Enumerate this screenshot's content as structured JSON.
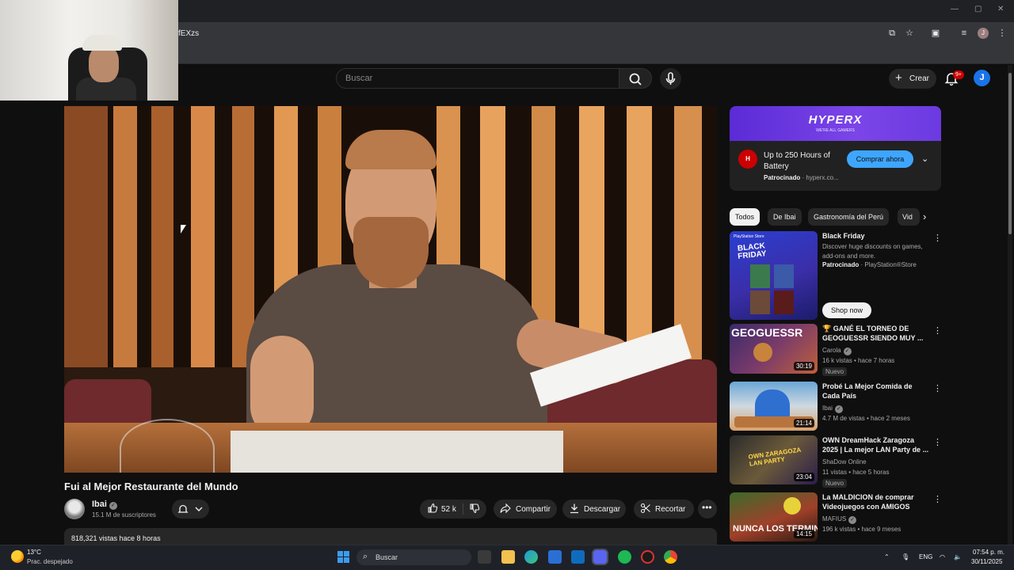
{
  "browser": {
    "url_fragment": "fEXzs",
    "profile_initial": "J"
  },
  "header": {
    "search_placeholder": "Buscar",
    "create_label": "Crear",
    "notifications_badge": "9+",
    "avatar_initial": "J"
  },
  "video": {
    "title": "Fui al Mejor Restaurante del Mundo",
    "channel": "Ibai",
    "subscribers": "15.1 M de suscriptores",
    "likes": "52 k",
    "share_label": "Compartir",
    "download_label": "Descargar",
    "clip_label": "Recortar",
    "views_time": "818,321 vistas  hace 8 horas"
  },
  "ad": {
    "brand_logo": "HYPERX",
    "slogan": "WE'RE ALL GAMERS",
    "icon_text": "H",
    "headline": "Up to 250 Hours of Battery",
    "sponsored": "Patrocinado",
    "domain": "hyperx.co...",
    "cta": "Comprar ahora"
  },
  "chips": [
    "Todos",
    "De Ibai",
    "Gastronomía del Perú",
    "Vid"
  ],
  "recommendations": [
    {
      "title": "Black Friday",
      "line1": "Discover huge discounts on games, add-ons and more.",
      "sponsored": "Patrocinado",
      "channel": "PlayStation®Store",
      "cta": "Shop now"
    },
    {
      "title": "🏆 GANÉ EL TORNEO DE GEOGUESSR SIENDO MUY ...",
      "channel": "Carola",
      "meta": "16 k vistas • hace 7 horas",
      "badge": "Nuevo",
      "duration": "30:19"
    },
    {
      "title": "Probé La Mejor Comida de Cada País",
      "channel": "Ibai",
      "meta": "4.7 M de vistas • hace 2 meses",
      "duration": "21:14"
    },
    {
      "title": "OWN DreamHack Zaragoza 2025 | La mejor LAN Party de ...",
      "channel": "ShaDow Online",
      "meta": "11 vistas • hace 5 horas",
      "badge": "Nuevo",
      "duration": "23:04"
    },
    {
      "title": "La MALDICION de comprar Videojuegos con AMIGOS",
      "channel": "MAFIUS",
      "meta": "196 k vistas • hace 9 meses",
      "duration": "14:15"
    }
  ],
  "thumb_text": {
    "ps_logo": "PlayStation Store",
    "bf_line1": "BLACK",
    "bf_line2": "FRIDAY",
    "geo": "GEOGUESSR",
    "zaragoza": "OWN ZARAGOZA LAN PARTY",
    "maldicion": "NUNCA LOS TERMINA"
  },
  "taskbar": {
    "temp": "13°C",
    "weather": "Prac. despejado",
    "search_placeholder": "Buscar",
    "lang": "ENG",
    "time": "07:54 p. m.",
    "date": "30/11/2025"
  },
  "colors": {
    "background": "#0f0f0f",
    "accent_blue": "#3ea6ff",
    "badge_red": "#cc0000",
    "ad_purple": "#6b3ae0"
  }
}
